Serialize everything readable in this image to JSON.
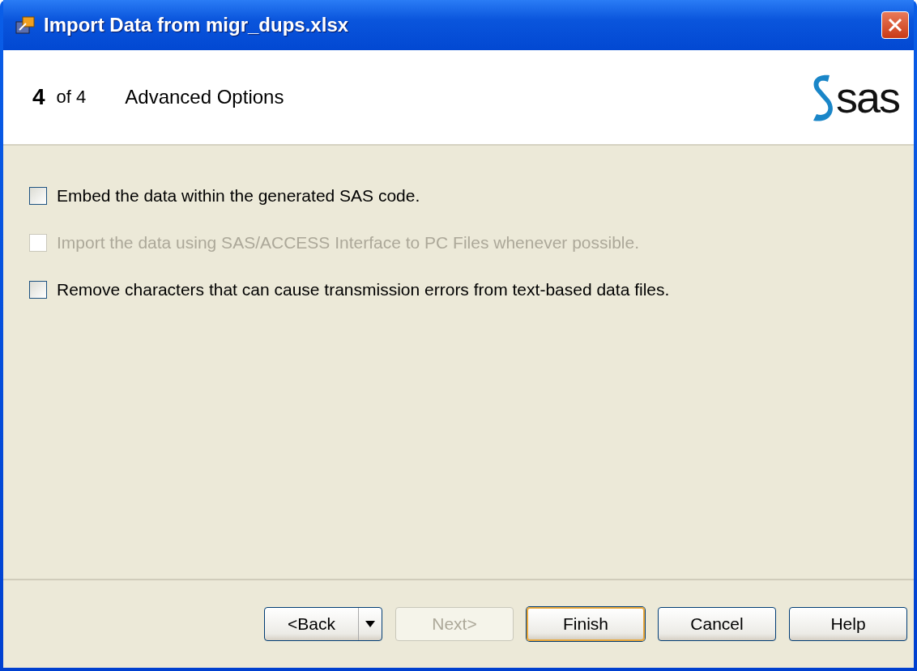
{
  "window": {
    "title": "Import Data from migr_dups.xlsx"
  },
  "header": {
    "step": "4",
    "of": "of 4",
    "title": "Advanced Options",
    "logo": "sas"
  },
  "options": [
    {
      "label": "Embed the data within the generated SAS code.",
      "checked": false,
      "disabled": false
    },
    {
      "label": "Import the data using SAS/ACCESS Interface to PC Files whenever possible.",
      "checked": false,
      "disabled": true
    },
    {
      "label": "Remove characters that can cause transmission errors from text-based data files.",
      "checked": false,
      "disabled": false
    }
  ],
  "buttons": [
    {
      "label": "<Back",
      "kind": "split",
      "disabled": false,
      "default": false
    },
    {
      "label": "Next>",
      "kind": "plain",
      "disabled": true,
      "default": false
    },
    {
      "label": "Finish",
      "kind": "plain",
      "disabled": false,
      "default": true
    },
    {
      "label": "Cancel",
      "kind": "plain",
      "disabled": false,
      "default": false
    },
    {
      "label": "Help",
      "kind": "plain",
      "disabled": false,
      "default": false
    }
  ]
}
